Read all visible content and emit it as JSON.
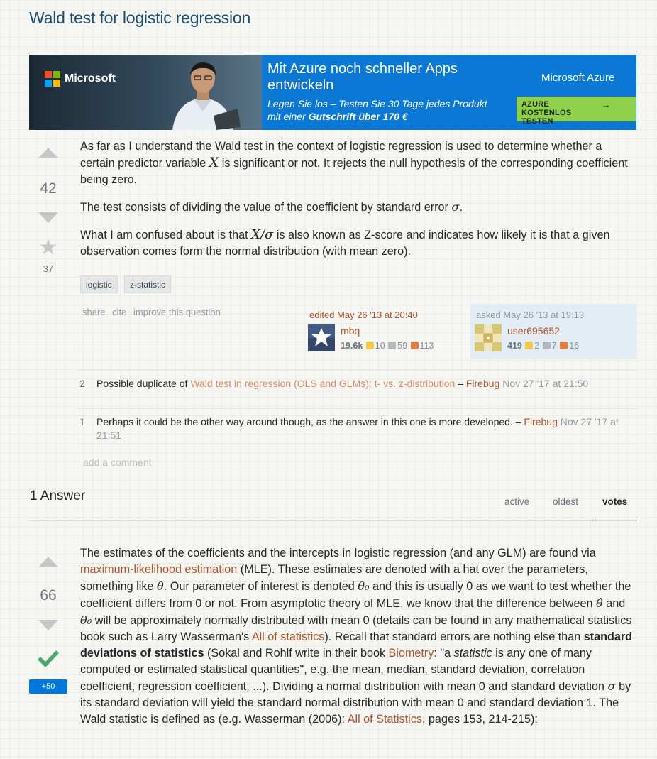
{
  "question": {
    "title": "Wald test for logistic regression",
    "score": "42",
    "favorites": "37",
    "body": {
      "p1_a": "As far as I understand the Wald test in the context of logistic regression is used to determine whether a certain predictor variable ",
      "p1_math": "X",
      "p1_b": " is significant or not. It rejects the null hypothesis of the corresponding coefficient being zero.",
      "p2_a": "The test consists of dividing the value of the coefficient by standard error ",
      "p2_math": "σ",
      "p2_b": ".",
      "p3_a": "What I am confused about is that ",
      "p3_math": "X/σ",
      "p3_b": " is also known as Z-score and indicates how likely it is that a given observation comes form the normal distribution (with mean zero)."
    },
    "tags": [
      "logistic",
      "z-statistic"
    ],
    "menu": [
      "share",
      "cite",
      "improve this question"
    ],
    "edited": {
      "action": "edited May 26 '13 at 20:40",
      "user": "mbq",
      "rep": "19.6k",
      "gold": "10",
      "silver": "59",
      "bronze": "113"
    },
    "asked": {
      "action": "asked May 26 '13 at 19:13",
      "user": "user695652",
      "rep": "419",
      "gold": "2",
      "silver": "7",
      "bronze": "16"
    }
  },
  "comments": [
    {
      "score": "2",
      "text_a": "Possible duplicate of ",
      "link": "Wald test in regression (OLS and GLMs): t- vs. z-distribution",
      "sep": " – ",
      "user": "Firebug",
      "date": " Nov 27 '17 at 21:50"
    },
    {
      "score": "1",
      "text_a": "Perhaps it could be the other way around though, as the answer in this one is more developed.",
      "sep": " – ",
      "user": "Firebug",
      "date": " Nov 27 '17 at 21:51"
    }
  ],
  "add_comment": "add a comment",
  "answers_header": "1 Answer",
  "sort_tabs": [
    "active",
    "oldest",
    "votes"
  ],
  "answer": {
    "score": "66",
    "bounty": "+50",
    "t1": "The estimates of the coefficients and the intercepts in logistic regression (and any GLM) are found via ",
    "l1": "maximum-likelihood estimation",
    "t2": " (MLE). These estimates are denoted with a hat over the parameters, something like ",
    "m1": "θ̂",
    "t3": ". Our parameter of interest is denoted ",
    "m2": "θ₀",
    "t4": " and this is usually 0 as we want to test whether the coefficient differs from 0 or not. From asymptotic theory of MLE, we know that the difference between ",
    "m3": "θ̂",
    "t5": " and ",
    "m4": "θ₀",
    "t6": " will be approximately normally distributed with mean 0 (details can be found in any mathematical statistics book such as Larry Wasserman's ",
    "l2": "All of statistics",
    "t7": "). Recall that standard errors are nothing else than ",
    "b1": "standard deviations of statistics",
    "t8": " (Sokal and Rohlf write in their book ",
    "l3": "Biometry",
    "t9": ": \"a ",
    "i1": "statistic",
    "t10": " is any one of many computed or estimated statistical quantities\", e.g. the mean, median, standard deviation, correlation coefficient, regression coefficient, ...). Dividing a normal distribution with mean 0 and standard deviation ",
    "m5": "σ",
    "t11": " by its standard deviation will yield the standard normal distribution with mean 0 and standard deviation 1. The Wald statistic is defined as (e.g. Wasserman (2006): ",
    "l4": "All of Statistics",
    "t12": ", pages 153, 214-215):"
  },
  "ad": {
    "brand_logo": "Microsoft",
    "headline": "Mit Azure noch schneller Apps entwickeln",
    "sub_a": "Legen Sie los – Testen Sie 30 Tage jedes Produkt mit einer ",
    "sub_b": "Gutschrift über 170 €",
    "brand": "Microsoft Azure",
    "cta": "AZURE KOSTENLOS TESTEN",
    "cta_arrow": "→",
    "logo_colors": [
      "#f25022",
      "#7fba00",
      "#00a4ef",
      "#ffb900"
    ]
  },
  "colors": {
    "title": "#1c4d70",
    "link": "#b0552d",
    "accepted": "#48a868",
    "bounty": "#0077dd"
  }
}
